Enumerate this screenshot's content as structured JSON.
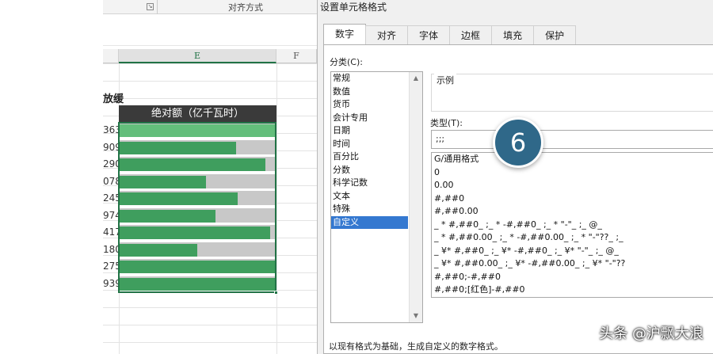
{
  "sheet": {
    "ribbon_group_label": "对齐方式",
    "ribbon_launcher": "↘",
    "columns": {
      "e": "E",
      "f": "F"
    },
    "section_title": "放缓",
    "table_header": "绝对额（亿千瓦时）",
    "rows": [
      {
        "label": "363",
        "fill": 1.0
      },
      {
        "label": "909",
        "fill": 0.75
      },
      {
        "label": "290",
        "fill": 0.94
      },
      {
        "label": "078",
        "fill": 0.56
      },
      {
        "label": "245",
        "fill": 0.76
      },
      {
        "label": "974",
        "fill": 0.62
      },
      {
        "label": "417",
        "fill": 0.97
      },
      {
        "label": "180",
        "fill": 0.5
      },
      {
        "label": "275",
        "fill": 1.0
      },
      {
        "label": "939",
        "fill": 1.0
      }
    ]
  },
  "dialog": {
    "title": "设置单元格格式",
    "tabs": [
      {
        "label": "数字"
      },
      {
        "label": "对齐"
      },
      {
        "label": "字体"
      },
      {
        "label": "边框"
      },
      {
        "label": "填充"
      },
      {
        "label": "保护"
      }
    ],
    "category_label": "分类(C):",
    "categories": [
      {
        "label": "常规"
      },
      {
        "label": "数值"
      },
      {
        "label": "货币"
      },
      {
        "label": "会计专用"
      },
      {
        "label": "日期"
      },
      {
        "label": "时间"
      },
      {
        "label": "百分比"
      },
      {
        "label": "分数"
      },
      {
        "label": "科学记数"
      },
      {
        "label": "文本"
      },
      {
        "label": "特殊"
      },
      {
        "label": "自定义"
      }
    ],
    "selected_category": "自定义",
    "sample_label": "示例",
    "type_label": "类型(T):",
    "type_value": ";;;",
    "formats": [
      "G/通用格式",
      "0",
      "0.00",
      "#,##0",
      "#,##0.00",
      "_ * #,##0_ ;_ * -#,##0_ ;_ * \"-\"_ ;_ @_",
      "_ * #,##0.00_ ;_ * -#,##0.00_ ;_ * \"-\"??_ ;_",
      "_ ¥* #,##0_ ;_ ¥* -#,##0_ ;_ ¥* \"-\"_ ;_ @_",
      "_ ¥* #,##0.00_ ;_ ¥* -#,##0.00_ ;_ ¥* \"-\"??",
      "#,##0;-#,##0",
      "#,##0;[红色]-#,##0"
    ],
    "description": "以现有格式为基础，生成自定义的数字格式。"
  },
  "badge": {
    "number": "6",
    "color": "#2f6889"
  },
  "watermark": "头条 @沪飘大浪"
}
